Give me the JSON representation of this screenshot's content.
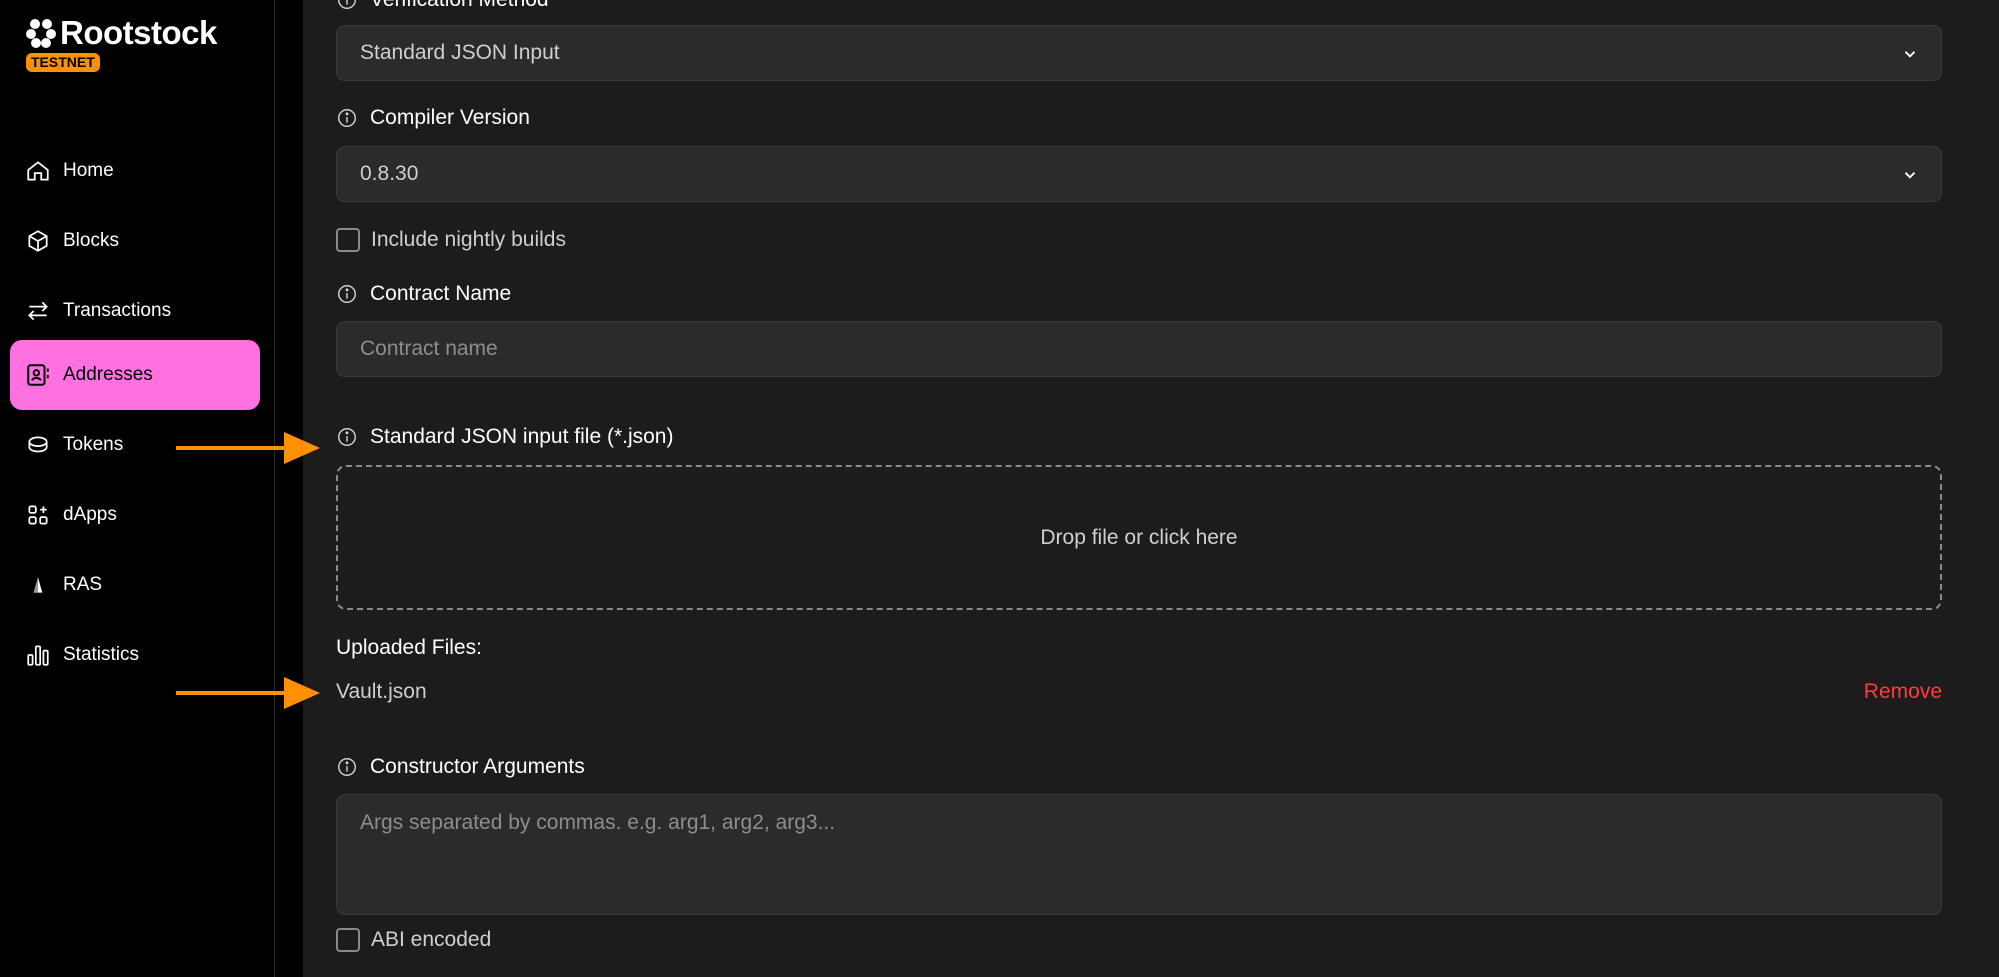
{
  "sidebar": {
    "brand": "Rootstock",
    "network_badge": "TESTNET",
    "items": [
      {
        "label": "Home",
        "icon": "home-icon"
      },
      {
        "label": "Blocks",
        "icon": "cube-icon"
      },
      {
        "label": "Transactions",
        "icon": "arrows-swap-icon"
      },
      {
        "label": "Addresses",
        "icon": "contact-card-icon",
        "active": true
      },
      {
        "label": "Tokens",
        "icon": "coins-icon"
      },
      {
        "label": "dApps",
        "icon": "apps-grid-plus-icon"
      },
      {
        "label": "RAS",
        "icon": "ras-triangle-icon"
      },
      {
        "label": "Statistics",
        "icon": "bar-chart-icon"
      }
    ]
  },
  "form": {
    "verification_method": {
      "label": "Verification Method",
      "value": "Standard JSON Input"
    },
    "compiler_version": {
      "label": "Compiler Version",
      "value": "0.8.30"
    },
    "nightly_builds_label": "Include nightly builds",
    "contract_name": {
      "label": "Contract Name",
      "placeholder": "Contract name"
    },
    "json_file": {
      "label": "Standard JSON input file (*.json)",
      "dropzone_text": "Drop file or click here"
    },
    "uploaded": {
      "title": "Uploaded Files:",
      "file_name": "Vault.json",
      "remove_label": "Remove"
    },
    "constructor_args": {
      "label": "Constructor Arguments",
      "placeholder": "Args separated by commas. e.g. arg1, arg2, arg3..."
    },
    "abi_encoded_label": "ABI encoded"
  },
  "colors": {
    "active_nav": "#ff71e1",
    "badge": "#ff9100",
    "remove": "#ff3b3b",
    "annotation_arrow": "#ff9100"
  }
}
